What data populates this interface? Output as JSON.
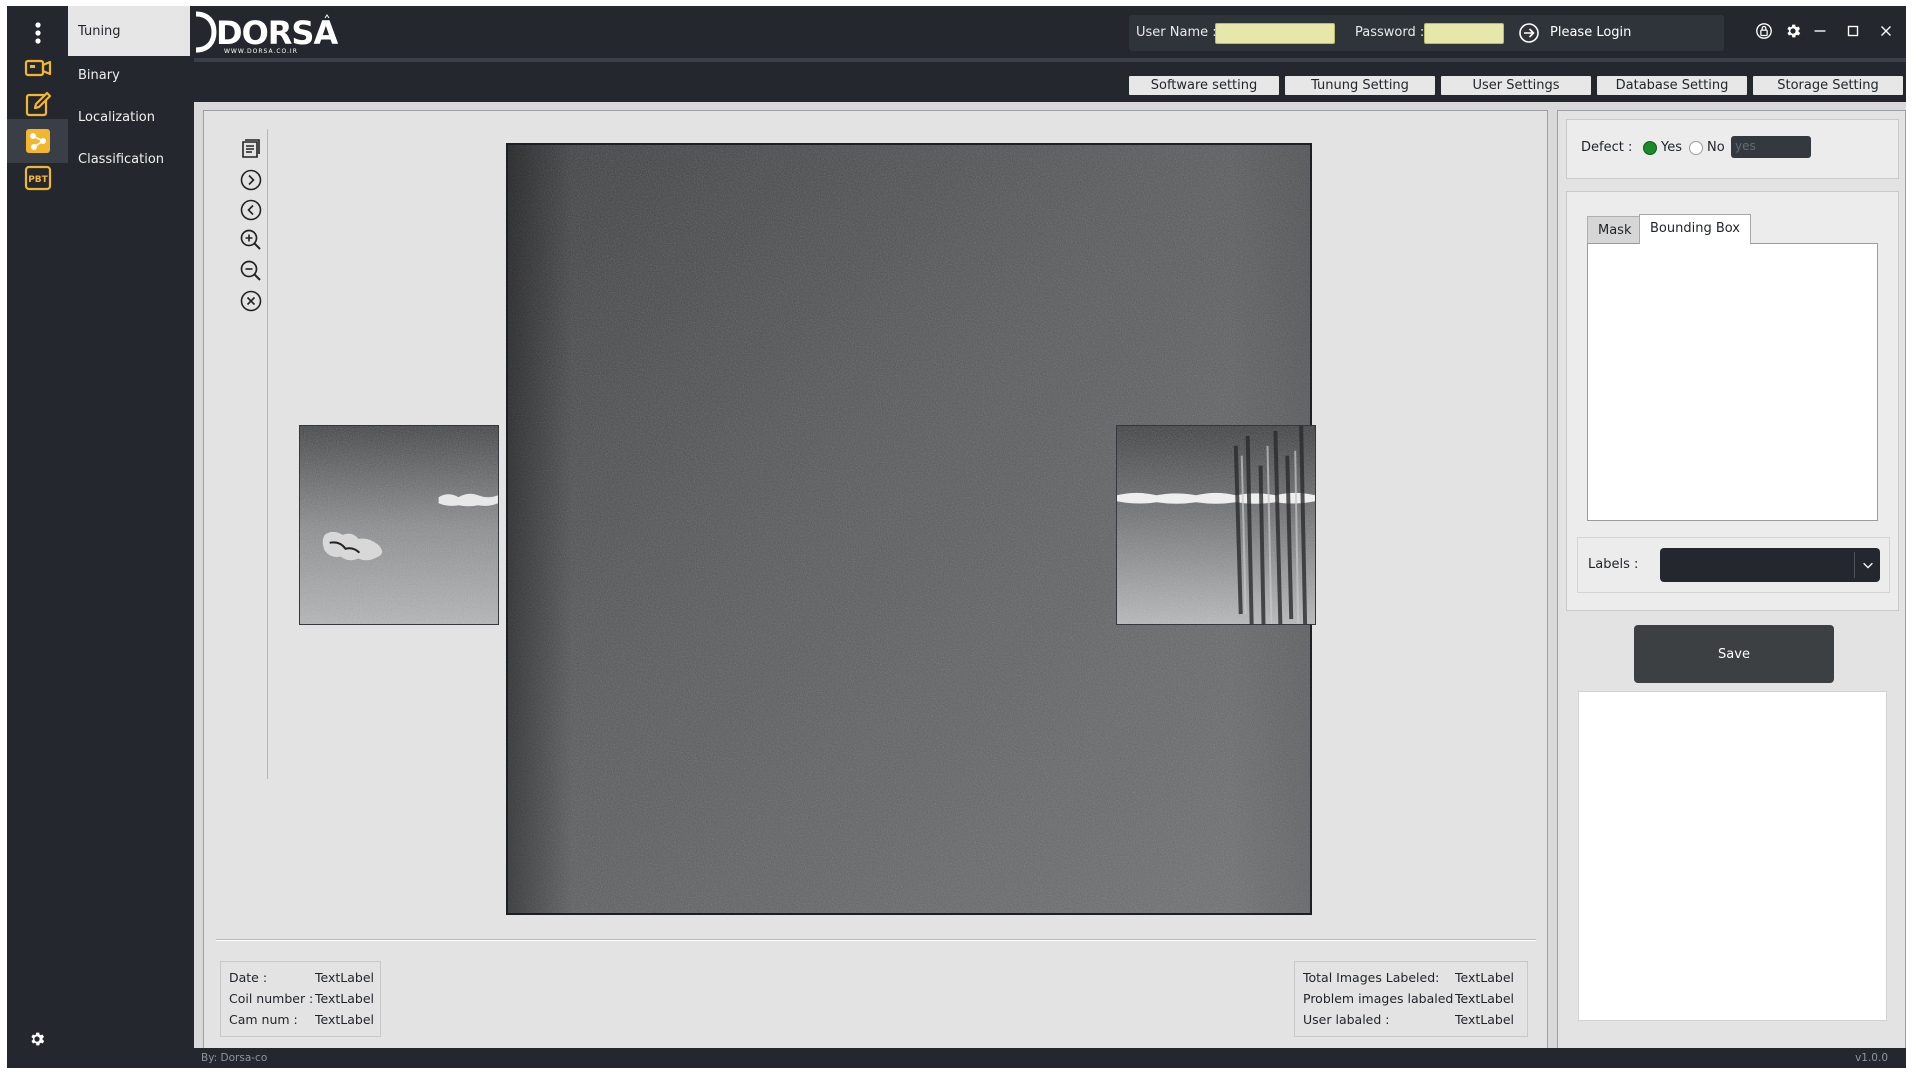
{
  "app": {
    "brand": "DORSA",
    "brand_sub": "WWW.DORSA.CO.IR"
  },
  "rail": {
    "items": [
      {
        "icon": "camera-icon"
      },
      {
        "icon": "edit-icon"
      },
      {
        "icon": "nodes-icon"
      },
      {
        "icon": "pbt-icon",
        "text": "PBT"
      }
    ],
    "bottom_icon": "gear-icon"
  },
  "subnav": {
    "items": [
      {
        "label": "Tuning",
        "active": true
      },
      {
        "label": "Binary"
      },
      {
        "label": "Localization"
      },
      {
        "label": "Classification"
      }
    ]
  },
  "login": {
    "username_label": "User Name :",
    "username_value": "",
    "password_label": "Password :",
    "password_value": "",
    "login_text": "Please Login"
  },
  "settings_tabs": [
    {
      "label": "Software setting"
    },
    {
      "label": "Tunung Setting"
    },
    {
      "label": "User Settings"
    },
    {
      "label": "Database Setting"
    },
    {
      "label": "Storage Setting"
    }
  ],
  "info_left": {
    "date_label": "Date :",
    "date_value": "TextLabel",
    "coil_label": "Coil number :",
    "coil_value": "TextLabel",
    "cam_label": "Cam num :",
    "cam_value": "TextLabel"
  },
  "info_right": {
    "total_label": "Total Images Labeled:",
    "total_value": "TextLabel",
    "problem_label": "Problem images labaled :",
    "problem_value": "TextLabel",
    "user_label": "User labaled :",
    "user_value": "TextLabel"
  },
  "defect": {
    "label": "Defect :",
    "yes_label": "Yes",
    "no_label": "No",
    "selected": "Yes",
    "field_value": "yes"
  },
  "annotation_tabs": {
    "mask_label": "Mask",
    "bbox_label": "Bounding Box",
    "active": "Bounding Box"
  },
  "labels": {
    "label": "Labels :",
    "selected": ""
  },
  "save_label": "Save",
  "footer": {
    "left": "By: Dorsa-co",
    "right": "v1.0.0"
  },
  "colors": {
    "dark": "#24282e",
    "accent": "#f2b630",
    "input_bg": "#e6e7a9",
    "defect_yes": "#1a8a2a"
  }
}
